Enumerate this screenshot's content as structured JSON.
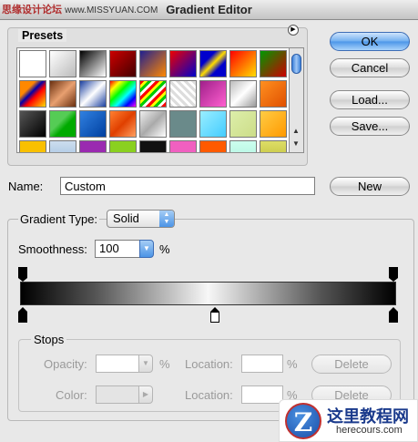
{
  "window": {
    "title": "Gradient Editor",
    "watermark": "思缘设计论坛",
    "watermark_site": "www.MISSYUAN.COM"
  },
  "presets": {
    "label": "Presets",
    "menu_icon": "triangle-right-icon"
  },
  "buttons": {
    "ok": "OK",
    "cancel": "Cancel",
    "load": "Load...",
    "save": "Save...",
    "new": "New",
    "delete": "Delete"
  },
  "name": {
    "label": "Name:",
    "value": "Custom"
  },
  "gradient": {
    "type_label": "Gradient Type:",
    "type_value": "Solid",
    "smoothness_label": "Smoothness:",
    "smoothness_value": "100",
    "percent": "%"
  },
  "stops": {
    "label": "Stops",
    "opacity_label": "Opacity:",
    "color_label": "Color:",
    "location_label": "Location:",
    "percent": "%"
  },
  "logo": {
    "cn": "这里教程网",
    "en": "herecours.com",
    "letter": "Z"
  },
  "colors": {
    "accent": "#4b95e8",
    "background": "#e8e8e8"
  }
}
